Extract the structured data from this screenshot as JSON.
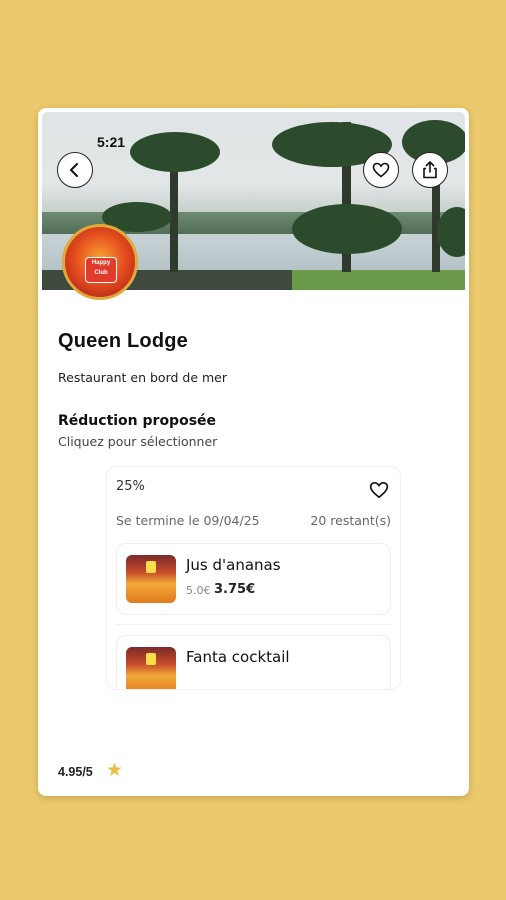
{
  "status_bar": {
    "time": "5:21"
  },
  "restaurant": {
    "name": "Queen Lodge",
    "description": "Restaurant en bord de mer",
    "logo_text": "Happy Club",
    "rating": "4.95/5"
  },
  "section": {
    "title": "Réduction proposée",
    "hint": "Cliquez pour sélectionner"
  },
  "offer": {
    "percent": "25%",
    "ends": "Se termine le 09/04/25",
    "remaining": "20 restant(s)",
    "items": [
      {
        "name": "Jus d'ananas",
        "old_price": "5.0€",
        "new_price": "3.75€"
      },
      {
        "name": "Fanta cocktail"
      }
    ]
  },
  "icons": {
    "back": "back-arrow-icon",
    "favorite": "heart-icon",
    "share": "share-icon",
    "star": "star-icon"
  },
  "colors": {
    "background": "#ecc96c",
    "star": "#e9c046"
  }
}
